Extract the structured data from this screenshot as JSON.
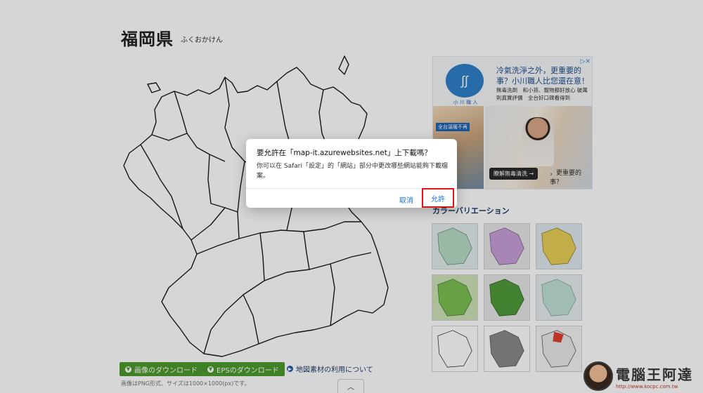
{
  "page": {
    "title": "福岡県",
    "subtitle": "ふくおかけん"
  },
  "ad": {
    "headline": "冷氣洗淨之外，更重要的事？小川職人比您還在意！",
    "copy": "無毒洗劑　和小孩、寵物都好放心 破萬則真實評價　全台好口碑看得到",
    "brand": "小 川 職 人",
    "badge": "全台溫暖不再",
    "cta": "瞭解無毒清洗 →",
    "tagline": "，更重要的事？",
    "close_icon": "ad-choices-icon"
  },
  "section": {
    "heading": "カラーバリエーション"
  },
  "thumbnails": {
    "colors": [
      "#b7dcc6",
      "#c7a0d9",
      "#e9cf56",
      "#7bbf53",
      "#4f9b3a",
      "#bfe0d8",
      "#ffffff",
      "#8a8a8a",
      "#e0402d"
    ]
  },
  "footer": {
    "png_button": "画像のダウンロード",
    "eps_button": "EPSのダウンロード",
    "terms_link": "地図素材の利用について",
    "note": "画像はPNG形式、サイズは1000×1000(px)です。"
  },
  "watermark": {
    "title": "電腦王阿達",
    "url": "http://www.kocpc.com.tw"
  },
  "dialog": {
    "title": "要允許在「map-it.azurewebsites.net」上下載嗎？",
    "body": "你可以在 Safari「設定」的「網站」部分中更改哪些網站能夠下載檔案。",
    "cancel_label": "取消",
    "allow_label": "允許",
    "highlight_color": "#e01515"
  }
}
